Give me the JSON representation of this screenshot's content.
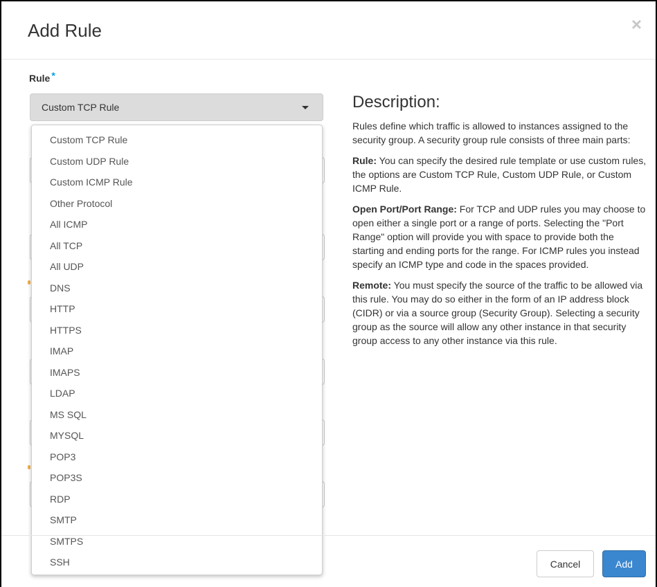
{
  "modal": {
    "title": "Add Rule",
    "close_symbol": "×"
  },
  "rule_field": {
    "label": "Rule",
    "required_marker": "*",
    "selected_value": "Custom TCP Rule",
    "options": [
      "Custom TCP Rule",
      "Custom UDP Rule",
      "Custom ICMP Rule",
      "Other Protocol",
      "All ICMP",
      "All TCP",
      "All UDP",
      "DNS",
      "HTTP",
      "HTTPS",
      "IMAP",
      "IMAPS",
      "LDAP",
      "MS SQL",
      "MYSQL",
      "POP3",
      "POP3S",
      "RDP",
      "SMTP",
      "SMTPS",
      "SSH"
    ]
  },
  "description": {
    "title": "Description:",
    "intro": "Rules define which traffic is allowed to instances assigned to the security group. A security group rule consists of three main parts:",
    "rule_heading": "Rule:",
    "rule_text": "You can specify the desired rule template or use custom rules, the options are Custom TCP Rule, Custom UDP Rule, or Custom ICMP Rule.",
    "port_heading": "Open Port/Port Range:",
    "port_text": "For TCP and UDP rules you may choose to open either a single port or a range of ports. Selecting the \"Port Range\" option will provide you with space to provide both the starting and ending ports for the range. For ICMP rules you instead specify an ICMP type and code in the spaces provided.",
    "remote_heading": "Remote:",
    "remote_text": "You must specify the source of the traffic to be allowed via this rule. You may do so either in the form of an IP address block (CIDR) or via a source group (Security Group). Selecting a security group as the source will allow any other instance in that security group access to any other instance via this rule."
  },
  "footer": {
    "cancel_label": "Cancel",
    "add_label": "Add"
  },
  "colors": {
    "primary": "#3a87d0",
    "required": "#00a0e4",
    "select_bg": "#dcdcdc"
  }
}
